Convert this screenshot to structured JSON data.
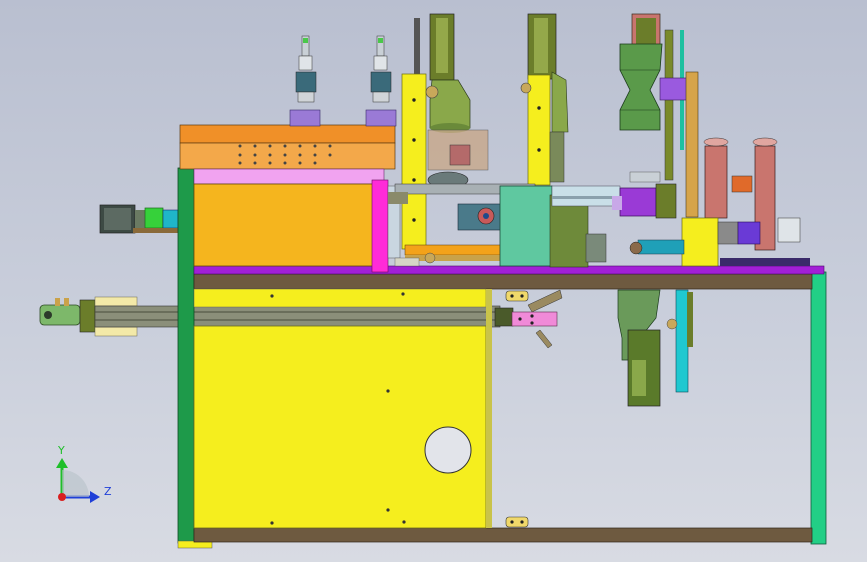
{
  "view": {
    "kind": "cad-model-viewport",
    "background_top": "#b9bfd0",
    "background_bottom": "#d8dbe3"
  },
  "triad": {
    "y_label": "Y",
    "z_label": "Z",
    "y_color": "#1fbf2a",
    "z_color": "#1f3fd8",
    "origin_color": "#d81f1f"
  },
  "colors": {
    "frame_green": "#1e9a4a",
    "rail_brown": "#6e5a40",
    "cabinet_yellow": "#f5ee1e",
    "block_orange": "#f3b21a",
    "deck_purple": "#a21fd6",
    "panel_pink": "#f07cf0",
    "olive": "#6b7d2a",
    "teal": "#5fc8a0",
    "salmon": "#c9756e",
    "grey_steel": "#9aa3a8"
  }
}
